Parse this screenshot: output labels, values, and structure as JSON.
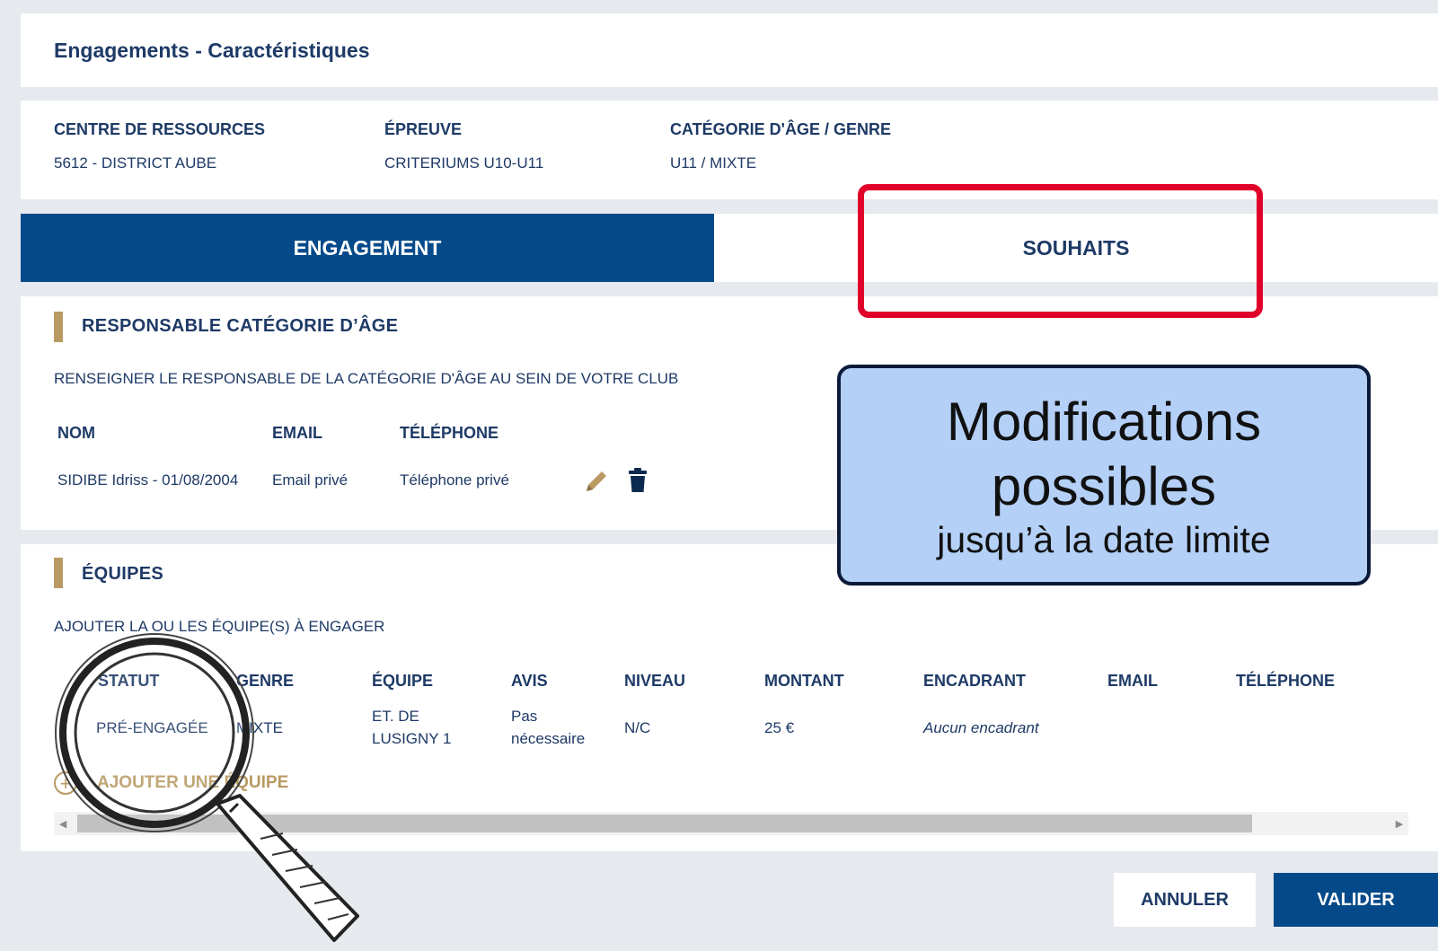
{
  "header": {
    "title": "Engagements - Caractéristiques"
  },
  "info": [
    {
      "label": "CENTRE DE RESSOURCES",
      "value": "5612 - DISTRICT AUBE"
    },
    {
      "label": "ÉPREUVE",
      "value": "CRITERIUMS U10-U11"
    },
    {
      "label": "CATÉGORIE D'ÂGE / GENRE",
      "value": "U11 / MIXTE"
    }
  ],
  "tabs": [
    {
      "label": "ENGAGEMENT",
      "active": true
    },
    {
      "label": "SOUHAITS",
      "active": false
    }
  ],
  "responsable": {
    "title": "RESPONSABLE CATÉGORIE D’ÂGE",
    "subtitle": "RENSEIGNER LE RESPONSABLE DE LA CATÉGORIE D'ÂGE AU SEIN DE VOTRE CLUB",
    "columns": [
      "NOM",
      "EMAIL",
      "TÉLÉPHONE"
    ],
    "row": {
      "nom": "SIDIBE Idriss - 01/08/2004",
      "email": "Email privé",
      "telephone": "Téléphone privé"
    },
    "icons": [
      "pencil-icon",
      "trash-icon"
    ]
  },
  "equipes": {
    "title": "ÉQUIPES",
    "subtitle": "AJOUTER LA OU LES ÉQUIPE(S) À ENGAGER",
    "columns": [
      "STATUT",
      "GENRE",
      "ÉQUIPE",
      "AVIS",
      "NIVEAU",
      "MONTANT",
      "ENCADRANT",
      "EMAIL",
      "TÉLÉPHONE"
    ],
    "rows": [
      {
        "statut": "PRÉ-ENGAGÉE",
        "genre": "MIXTE",
        "equipe_line1": "ET. DE",
        "equipe_line2": "LUSIGNY 1",
        "avis_line1": "Pas",
        "avis_line2": "nécessaire",
        "niveau": "N/C",
        "montant": "25 €",
        "encadrant": "Aucun encadrant",
        "email": "",
        "telephone": ""
      }
    ],
    "add_label": "AJOUTER UNE ÉQUIPE"
  },
  "actions": {
    "cancel": "ANNULER",
    "validate": "VALIDER"
  },
  "callout": {
    "main_line1": "Modifications",
    "main_line2": "possibles",
    "sub": "jusqu’à la date limite"
  },
  "colors": {
    "primary": "#044a8a",
    "accent_gold": "#b89a62",
    "highlight_red": "#e0002a",
    "callout_bg": "#b4d0f7",
    "text": "#1e3a66"
  }
}
